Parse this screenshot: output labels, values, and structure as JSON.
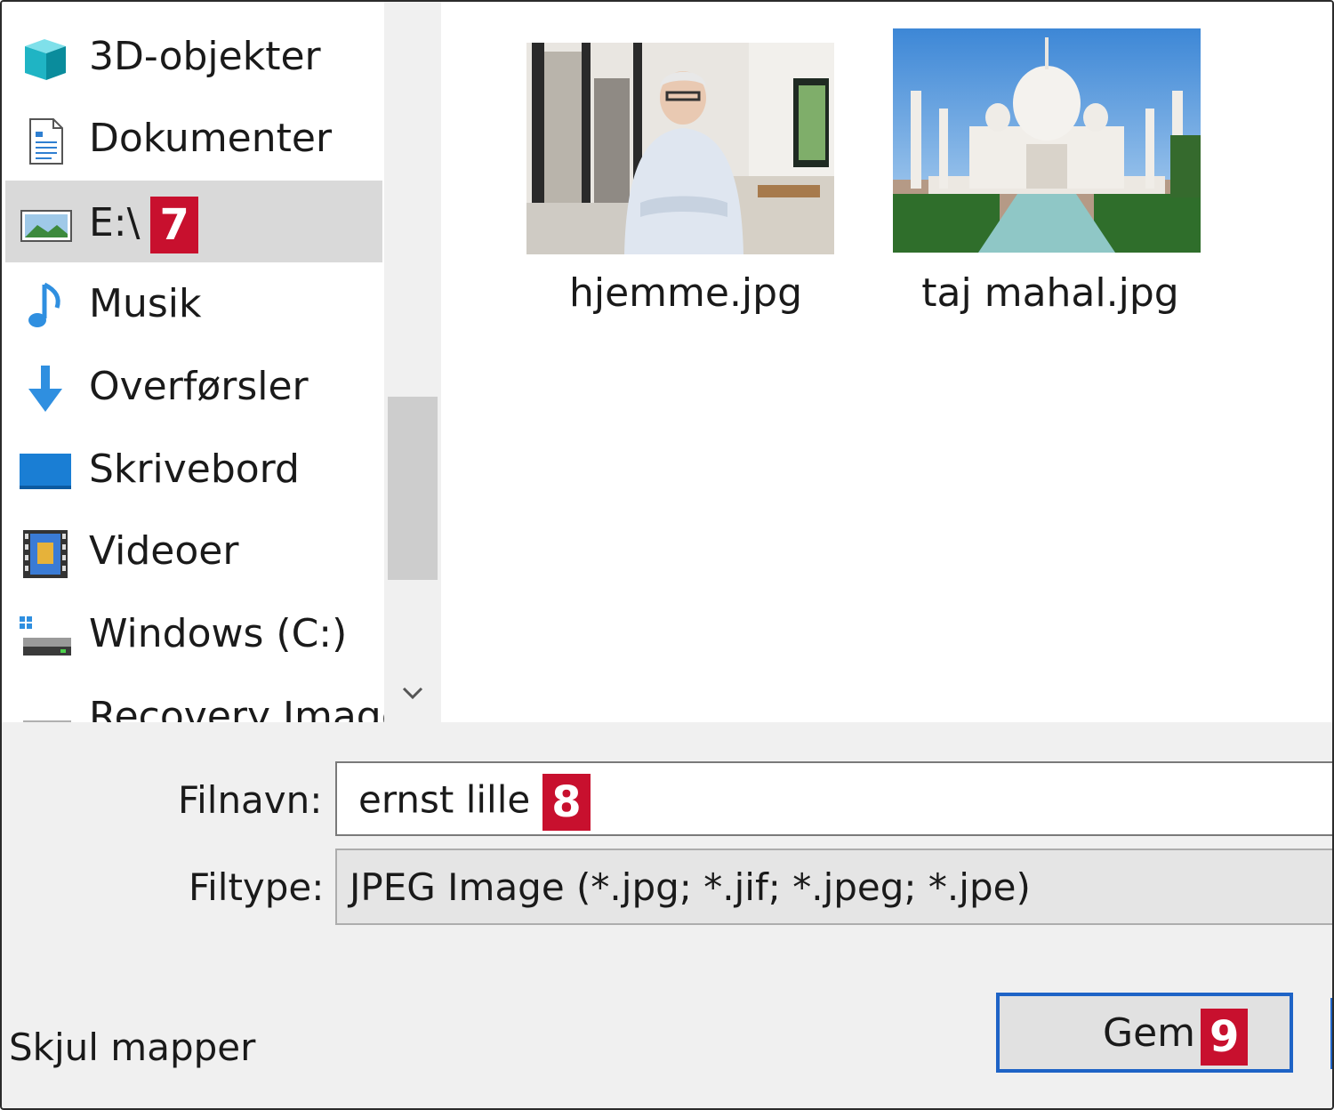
{
  "nav": {
    "items": [
      {
        "label": "3D-objekter",
        "icon": "3d-objects-icon"
      },
      {
        "label": "Dokumenter",
        "icon": "documents-icon"
      },
      {
        "label": "E:\\",
        "icon": "drive-picture-icon",
        "badge": "7",
        "selected": true
      },
      {
        "label": "Musik",
        "icon": "music-icon"
      },
      {
        "label": "Overførsler",
        "icon": "downloads-icon"
      },
      {
        "label": "Skrivebord",
        "icon": "desktop-icon"
      },
      {
        "label": "Videoer",
        "icon": "videos-icon"
      },
      {
        "label": "Windows (C:)",
        "icon": "windows-drive-icon"
      },
      {
        "label": "Recovery Image",
        "icon": "recovery-drive-icon"
      }
    ]
  },
  "files": [
    {
      "name": "hjemme.jpg"
    },
    {
      "name": "taj mahal.jpg"
    }
  ],
  "form": {
    "filename_label": "Filnavn:",
    "filename_value": "ernst lille",
    "filename_badge": "8",
    "filetype_label": "Filtype:",
    "filetype_value": "JPEG Image (*.jpg; *.jif; *.jpeg; *.jpe)"
  },
  "actions": {
    "save_label": "Gem",
    "save_badge": "9",
    "hide_folders_label": "Skjul mapper"
  },
  "colors": {
    "selection": "#d9d9d9",
    "badge": "#c8102e",
    "focus_border": "#1e63c6"
  }
}
